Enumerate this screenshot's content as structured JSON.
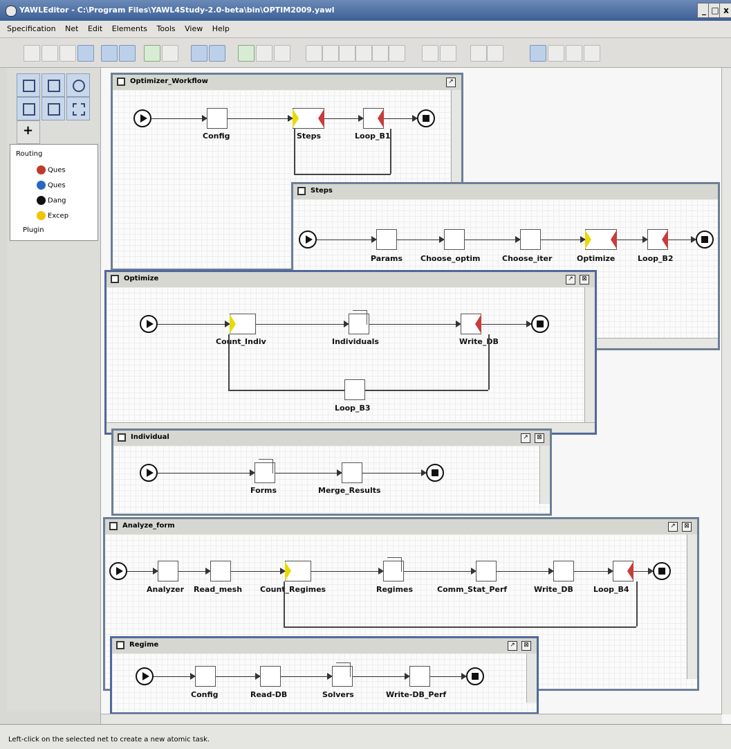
{
  "window": {
    "title": "YAWLEditor - C:\\Program Files\\YAWL4Study-2.0-beta\\bin\\OPTIM2009.yawl",
    "minimize": "_",
    "restore": "□",
    "close": "x"
  },
  "menu": [
    "Specification",
    "Net",
    "Edit",
    "Elements",
    "Tools",
    "View",
    "Help"
  ],
  "tree": {
    "root": "Routing",
    "items": [
      "Ques",
      "Ques",
      "Dang",
      "Excep"
    ],
    "plugin": "Plugin"
  },
  "nets": {
    "optimizer": {
      "title": "Optimizer_Workflow",
      "tasks": [
        "Config",
        "Steps",
        "Loop_B1"
      ]
    },
    "steps": {
      "title": "Steps",
      "tasks": [
        "Params",
        "Choose_optim",
        "Choose_iter",
        "Optimize",
        "Loop_B2"
      ]
    },
    "optimize": {
      "title": "Optimize",
      "tasks": [
        "Count_Indiv",
        "Individuals",
        "Write_DB",
        "Loop_B3"
      ]
    },
    "individual": {
      "title": "Individual",
      "tasks": [
        "Forms",
        "Merge_Results"
      ]
    },
    "analyze": {
      "title": "Analyze_form",
      "tasks": [
        "Analyzer",
        "Read_mesh",
        "Count_Regimes",
        "Regimes",
        "Comm_Stat_Perf",
        "Write_DB",
        "Loop_B4"
      ]
    },
    "regime": {
      "title": "Regime",
      "tasks": [
        "Config",
        "Read-DB",
        "Solvers",
        "Write-DB_Perf"
      ]
    }
  },
  "status": "Left-click on the selected net to create a new atomic task."
}
